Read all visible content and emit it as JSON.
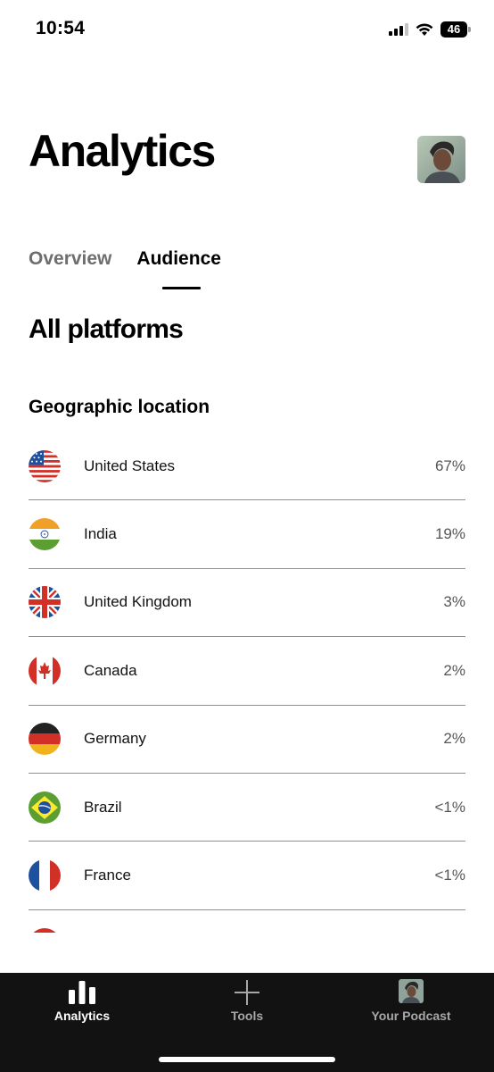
{
  "status_bar": {
    "time": "10:54",
    "battery_level": "46",
    "icons": [
      "signal-icon",
      "wifi-icon",
      "battery-icon"
    ]
  },
  "header": {
    "title": "Analytics",
    "avatar": "profile-avatar"
  },
  "tabs": [
    {
      "label": "Overview",
      "active": false
    },
    {
      "label": "Audience",
      "active": true
    }
  ],
  "section": {
    "title": "All platforms",
    "subtitle": "Geographic location"
  },
  "geo": [
    {
      "country": "United States",
      "percent": "67%",
      "flag": "us-flag-icon"
    },
    {
      "country": "India",
      "percent": "19%",
      "flag": "india-flag-icon"
    },
    {
      "country": "United Kingdom",
      "percent": "3%",
      "flag": "uk-flag-icon"
    },
    {
      "country": "Canada",
      "percent": "2%",
      "flag": "canada-flag-icon"
    },
    {
      "country": "Germany",
      "percent": "2%",
      "flag": "germany-flag-icon"
    },
    {
      "country": "Brazil",
      "percent": "<1%",
      "flag": "brazil-flag-icon"
    },
    {
      "country": "France",
      "percent": "<1%",
      "flag": "france-flag-icon"
    }
  ],
  "bottom_nav": {
    "items": [
      {
        "label": "Analytics",
        "icon": "bar-chart-icon",
        "active": true
      },
      {
        "label": "Tools",
        "icon": "plus-icon",
        "active": false
      },
      {
        "label": "Your Podcast",
        "icon": "podcast-avatar-icon",
        "active": false
      }
    ]
  },
  "colors": {
    "background": "#ffffff",
    "text": "#000000",
    "muted": "#6e6e6e",
    "divider": "#8f8f8f",
    "nav_background": "#121212",
    "nav_inactive": "#a7a7a7"
  }
}
